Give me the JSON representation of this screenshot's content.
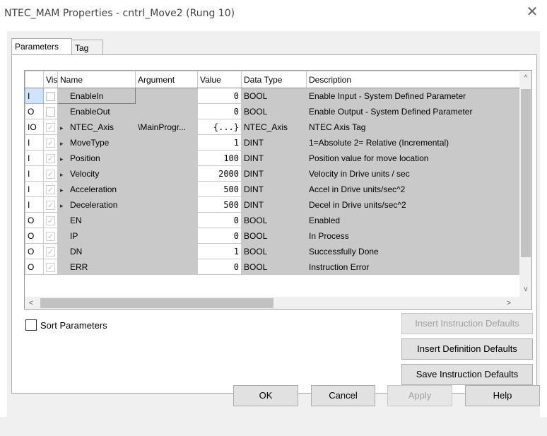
{
  "window": {
    "title": "NTEC_MAM Properties - cntrl_Move2 (Rung 10)",
    "close_glyph": "✕"
  },
  "tabs": [
    {
      "label": "Parameters",
      "active": true
    },
    {
      "label": "Tag",
      "active": false
    }
  ],
  "grid": {
    "columns": {
      "usage": "",
      "vis": "Vis",
      "name": "Name",
      "argument": "Argument",
      "value": "Value",
      "data_type": "Data Type",
      "description": "Description"
    },
    "rows": [
      {
        "usage": "I",
        "vis": "",
        "expandable": false,
        "name": "EnableIn",
        "argument": "",
        "value": "0",
        "data_type": "BOOL",
        "description": "Enable Input - System Defined Parameter"
      },
      {
        "usage": "O",
        "vis": "",
        "expandable": false,
        "name": "EnableOut",
        "argument": "",
        "value": "0",
        "data_type": "BOOL",
        "description": "Enable Output - System Defined Parameter"
      },
      {
        "usage": "IO",
        "vis": "✓",
        "expandable": true,
        "name": "NTEC_Axis",
        "argument": "\\MainProgr...",
        "value": "{...}",
        "data_type": "NTEC_Axis",
        "description": "NTEC Axis Tag"
      },
      {
        "usage": "I",
        "vis": "✓",
        "expandable": true,
        "name": "MoveType",
        "argument": "",
        "value": "1",
        "data_type": "DINT",
        "description": "1=Absolute 2= Relative (Incremental)"
      },
      {
        "usage": "I",
        "vis": "✓",
        "expandable": true,
        "name": "Position",
        "argument": "",
        "value": "100",
        "data_type": "DINT",
        "description": "Position value for move location"
      },
      {
        "usage": "I",
        "vis": "✓",
        "expandable": true,
        "name": "Velocity",
        "argument": "",
        "value": "2000",
        "data_type": "DINT",
        "description": "Velocity in Drive units / sec"
      },
      {
        "usage": "I",
        "vis": "✓",
        "expandable": true,
        "name": "Acceleration",
        "argument": "",
        "value": "500",
        "data_type": "DINT",
        "description": "Accel in Drive units/sec^2"
      },
      {
        "usage": "I",
        "vis": "✓",
        "expandable": true,
        "name": "Deceleration",
        "argument": "",
        "value": "500",
        "data_type": "DINT",
        "description": "Decel in Drive units/sec^2"
      },
      {
        "usage": "O",
        "vis": "✓",
        "expandable": false,
        "name": "EN",
        "argument": "",
        "value": "0",
        "data_type": "BOOL",
        "description": "Enabled"
      },
      {
        "usage": "O",
        "vis": "✓",
        "expandable": false,
        "name": "IP",
        "argument": "",
        "value": "0",
        "data_type": "BOOL",
        "description": "In Process"
      },
      {
        "usage": "O",
        "vis": "✓",
        "expandable": false,
        "name": "DN",
        "argument": "",
        "value": "1",
        "data_type": "BOOL",
        "description": "Successfully Done"
      },
      {
        "usage": "O",
        "vis": "✓",
        "expandable": false,
        "name": "ERR",
        "argument": "",
        "value": "0",
        "data_type": "BOOL",
        "description": "Instruction Error"
      }
    ],
    "scroll": {
      "up": "^",
      "down": "v",
      "left": "<",
      "right": ">"
    }
  },
  "sort_parameters": {
    "label": "Sort Parameters",
    "checked": false
  },
  "buttons": {
    "insert_instruction_defaults": "Insert Instruction Defaults",
    "insert_definition_defaults": "Insert Definition Defaults",
    "save_instruction_defaults": "Save Instruction Defaults",
    "ok": "OK",
    "cancel": "Cancel",
    "apply": "Apply",
    "help": "Help"
  },
  "icons": {
    "expander": "triangle-right-icon",
    "checkmark": "check-icon"
  }
}
